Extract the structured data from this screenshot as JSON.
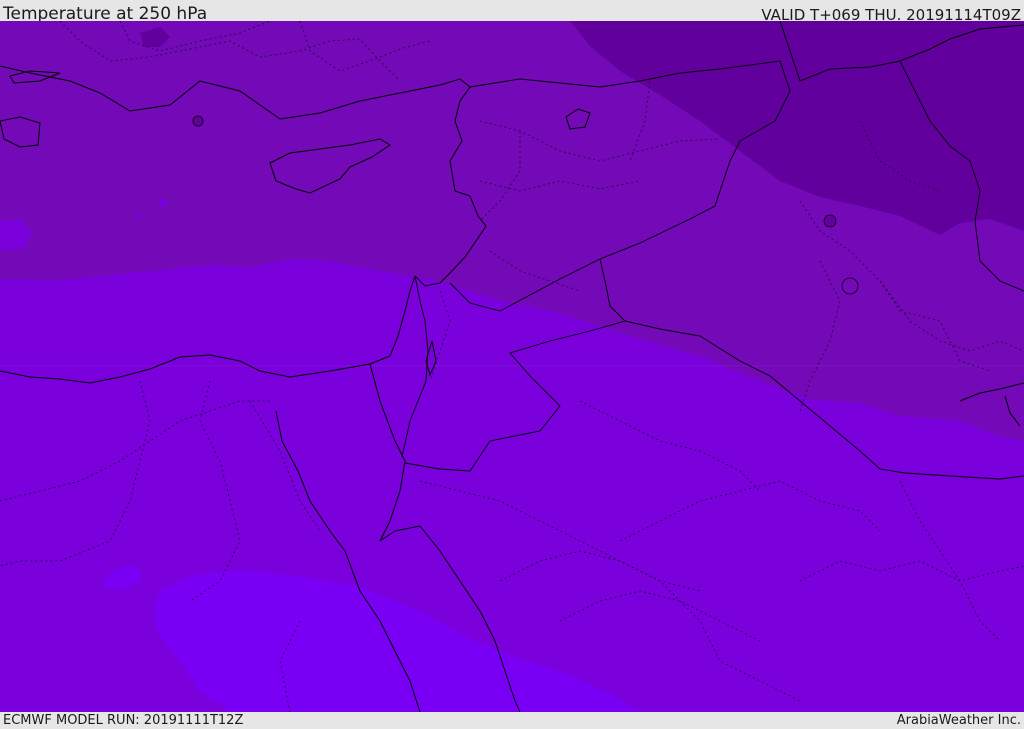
{
  "header": {
    "title": "Temperature at 250 hPa",
    "valid": "VALID T+069 THU. 20191114T09Z"
  },
  "footer": {
    "model_run": "ECMWF MODEL RUN: 20191111T12Z",
    "credit": "ArabiaWeather Inc."
  },
  "map": {
    "fill_colors": {
      "coldest_band": "#62009e",
      "cold_band": "#7309b7",
      "main_band": "#7a00dc",
      "warm_band": "#7a00f5"
    },
    "line_colors": {
      "coastline": "#000000",
      "borders": "#1b0a3a"
    }
  }
}
